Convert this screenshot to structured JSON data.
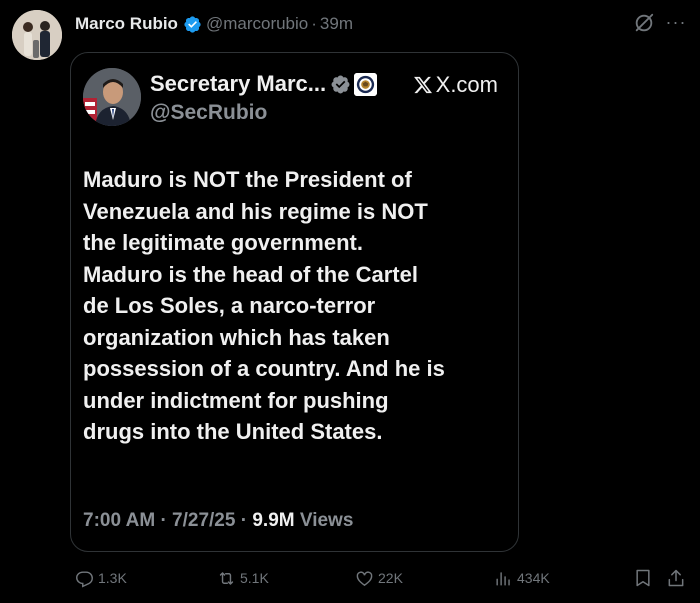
{
  "post": {
    "author_name": "Marco Rubio",
    "handle": "@marcorubio",
    "separator": "·",
    "time_ago": "39m"
  },
  "embed": {
    "author_name": "Secretary Marc...",
    "handle": "@SecRubio",
    "source": "X.com",
    "text": "Maduro is NOT the President of\nVenezuela and his regime is NOT\nthe legitimate government.\nMaduro is the head of the Cartel\nde Los Soles, a narco-terror\norganization which has taken\npossession of a country.  And he is\nunder indictment for pushing\ndrugs into the United States.",
    "time": "7:00 AM",
    "date": "7/27/25",
    "separator": "·",
    "views_count": "9.9M",
    "views_label": "Views"
  },
  "actions": {
    "replies": "1.3K",
    "reposts": "5.1K",
    "likes": "22K",
    "views": "434K"
  },
  "colors": {
    "background": "#000000",
    "text": "#e7e9ea",
    "muted": "#71767b",
    "verified": "#1d9bf0",
    "border": "#2f3336"
  },
  "icons": {
    "verified": "verified-badge-icon",
    "grok": "grok-icon",
    "more": "more-icon",
    "reply": "reply-icon",
    "repost": "repost-icon",
    "like": "heart-icon",
    "views": "analytics-icon",
    "bookmark": "bookmark-icon",
    "share": "share-icon",
    "x_logo": "x-logo-icon",
    "seal": "state-department-seal-icon"
  }
}
